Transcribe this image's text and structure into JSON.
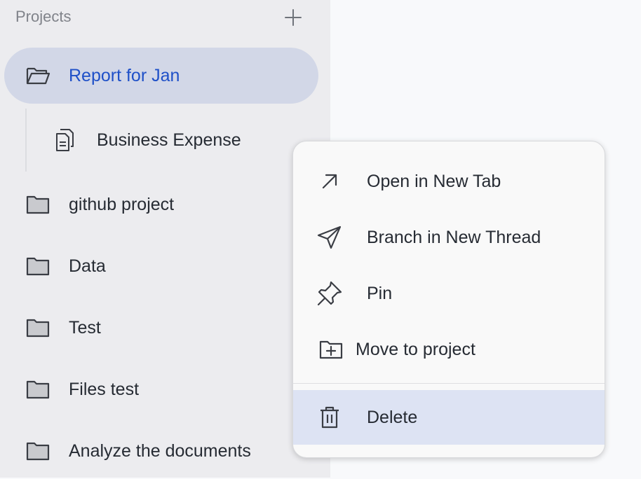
{
  "sidebar": {
    "header": "Projects",
    "add_icon": "plus-icon",
    "selected_project": {
      "label": "Report for Jan",
      "icon": "folder-open-icon"
    },
    "sub_item": {
      "label": "Business Expense",
      "icon": "document-icon"
    },
    "projects": [
      {
        "label": "github project",
        "icon": "folder-icon"
      },
      {
        "label": "Data",
        "icon": "folder-icon"
      },
      {
        "label": "Test",
        "icon": "folder-icon"
      },
      {
        "label": "Files test",
        "icon": "folder-icon"
      },
      {
        "label": "Analyze the documents",
        "icon": "folder-icon"
      }
    ]
  },
  "context_menu": {
    "items": [
      {
        "label": "Open in New Tab",
        "icon": "arrow-up-right-icon"
      },
      {
        "label": "Branch in New Thread",
        "icon": "send-icon"
      },
      {
        "label": "Pin",
        "icon": "pin-icon"
      },
      {
        "label": "Move to project",
        "icon": "folder-plus-icon"
      },
      {
        "label": "Delete",
        "icon": "trash-icon"
      }
    ]
  },
  "colors": {
    "sidebar_bg": "#ececef",
    "selected_bg": "#d2d7e7",
    "selected_text": "#1f50c8",
    "delete_highlight": "#dde3f3"
  }
}
